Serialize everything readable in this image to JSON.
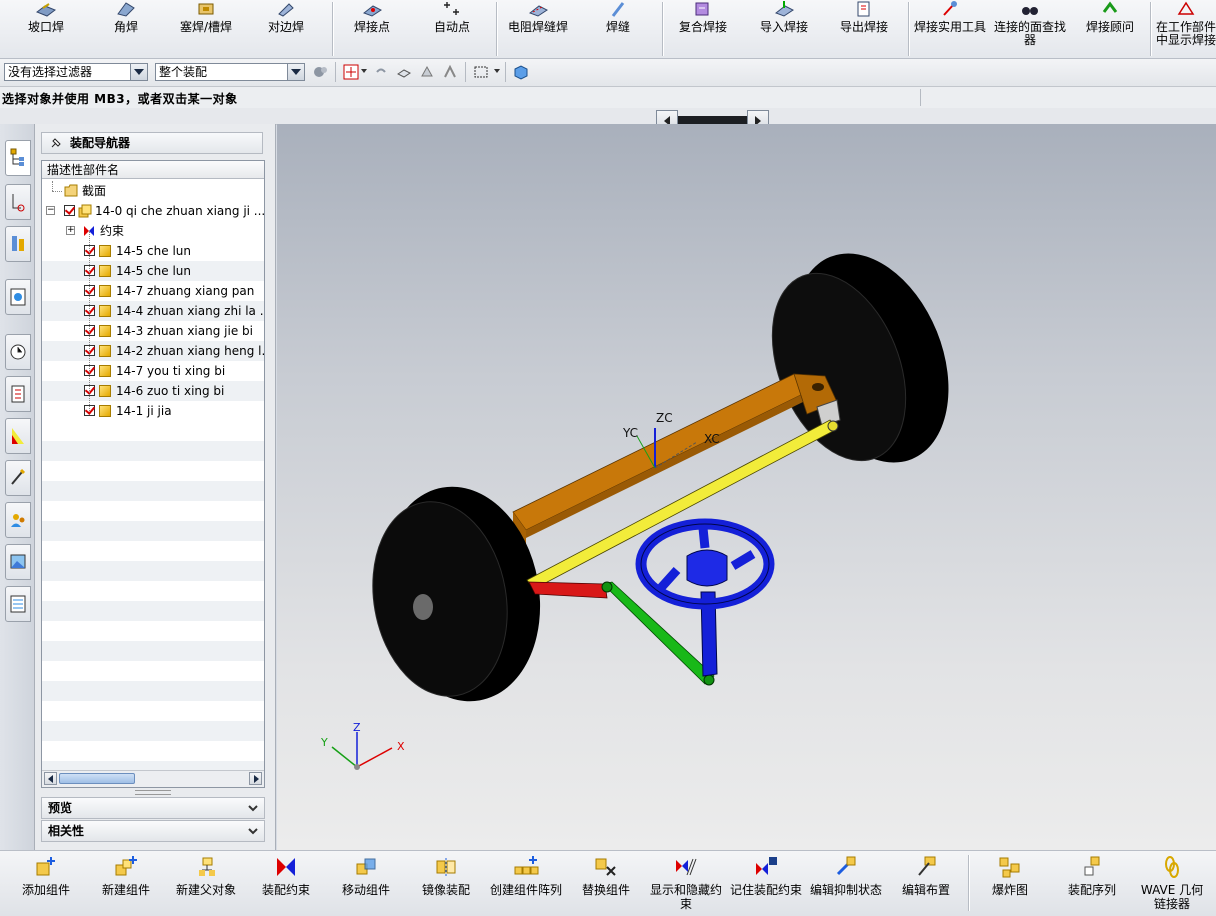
{
  "top_toolbar": {
    "items": [
      {
        "label": "坡口焊"
      },
      {
        "label": "角焊"
      },
      {
        "label": "塞焊/槽焊"
      },
      {
        "label": "对边焊"
      },
      {
        "label": "焊接点"
      },
      {
        "label": "自动点"
      },
      {
        "label": "电阻焊缝焊"
      },
      {
        "label": "焊缝"
      },
      {
        "label": "复合焊接"
      },
      {
        "label": "导入焊接"
      },
      {
        "label": "导出焊接"
      },
      {
        "label": "焊接实用工具"
      },
      {
        "label": "连接的面查找器"
      },
      {
        "label": "焊接顾问"
      },
      {
        "label": "在工作部件中显示焊接"
      }
    ]
  },
  "filter_bar": {
    "selection_filter": "没有选择过滤器",
    "scope": "整个装配"
  },
  "status": {
    "prompt": "选择对象并使用 MB3，或者双击某一对象"
  },
  "navigator": {
    "title": "装配导航器",
    "column_header": "描述性部件名",
    "tree": [
      {
        "label": "截面",
        "indent": 1
      },
      {
        "label": "14-0  qi che zhuan xiang ji ...",
        "indent": 0
      },
      {
        "label": "约束",
        "indent": 1
      },
      {
        "label": "14-5 che lun",
        "indent": 2
      },
      {
        "label": "14-5 che lun",
        "indent": 2
      },
      {
        "label": "14-7 zhuang xiang pan",
        "indent": 2
      },
      {
        "label": "14-4 zhuan xiang zhi la ...",
        "indent": 2
      },
      {
        "label": "14-3 zhuan xiang jie bi",
        "indent": 2
      },
      {
        "label": "14-2 zhuan xiang heng l...",
        "indent": 2
      },
      {
        "label": "14-7 you ti xing bi",
        "indent": 2
      },
      {
        "label": "14-6 zuo ti xing bi",
        "indent": 2
      },
      {
        "label": "14-1 ji jia",
        "indent": 2
      }
    ],
    "preview_label": "预览",
    "dependencies_label": "相关性"
  },
  "viewport": {
    "wcs_labels": {
      "yc": "YC",
      "zc": "ZC",
      "xc": "XC"
    },
    "triad_labels": {
      "x": "X",
      "y": "Y",
      "z": "Z"
    }
  },
  "bottom_toolbar": {
    "items": [
      {
        "label": "添加组件"
      },
      {
        "label": "新建组件"
      },
      {
        "label": "新建父对象"
      },
      {
        "label": "装配约束"
      },
      {
        "label": "移动组件"
      },
      {
        "label": "镜像装配"
      },
      {
        "label": "创建组件阵列"
      },
      {
        "label": "替换组件"
      },
      {
        "label": "显示和隐藏约束"
      },
      {
        "label": "记住装配约束"
      },
      {
        "label": "编辑抑制状态"
      },
      {
        "label": "编辑布置"
      },
      {
        "label": "爆炸图"
      },
      {
        "label": "装配序列"
      },
      {
        "label": "WAVE 几何链接器"
      }
    ]
  },
  "colors": {
    "wheel": "#0a0a0a",
    "chassis": "#c8780a",
    "tie_rod": "#f2ec3a",
    "steering_wheel": "#1420d8",
    "left_arm": "#d81818",
    "right_arm": "#18b818"
  }
}
